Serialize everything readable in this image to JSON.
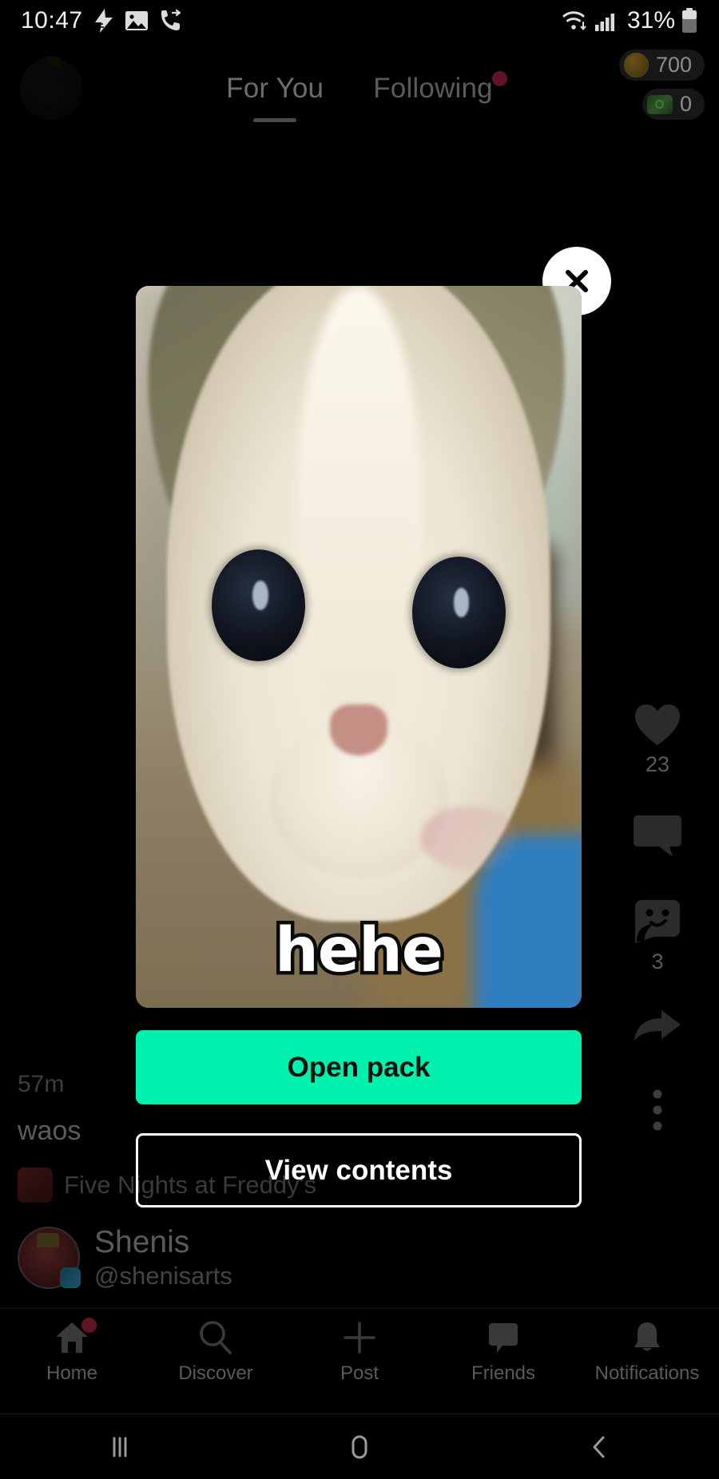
{
  "status_bar": {
    "time": "10:47",
    "battery_percent": "31%",
    "left_icons": [
      "flash-icon",
      "photo-icon",
      "call-forward-icon"
    ],
    "right_icons": [
      "wifi-icon",
      "cellular-signal-icon",
      "battery-icon"
    ]
  },
  "top_bar": {
    "avatar_name": "profile-avatar",
    "tabs": [
      {
        "label": "For You",
        "active": true,
        "has_dot": false
      },
      {
        "label": "Following",
        "active": false,
        "has_dot": true
      }
    ]
  },
  "currency": {
    "coins": {
      "icon": "coin-icon",
      "value": "700"
    },
    "cash": {
      "icon": "money-bill-icon",
      "value": "0"
    }
  },
  "action_rail": {
    "like": {
      "icon": "heart-icon",
      "count": "23"
    },
    "comment": {
      "icon": "comment-bubble-icon",
      "count": ""
    },
    "sticker": {
      "icon": "sticker-face-icon",
      "count": "3"
    },
    "share": {
      "icon": "share-arrow-icon",
      "count": ""
    },
    "more": {
      "icon": "more-vertical-icon",
      "count": ""
    }
  },
  "post_meta": {
    "timestamp": "57m",
    "caption": "waos",
    "game_tag": "Five Nights at Freddy's",
    "game_thumb": "game-thumbnail",
    "display_name": "Shenis",
    "handle": "@shenisarts"
  },
  "modal": {
    "close_label": "✕",
    "card_image_text": "hehe",
    "card_image_alt": "kitten-meme-image",
    "primary_button": "Open pack",
    "secondary_button": "View contents"
  },
  "bottom_nav": [
    {
      "label": "Home",
      "icon": "home-icon",
      "badge": true
    },
    {
      "label": "Discover",
      "icon": "search-icon",
      "badge": false
    },
    {
      "label": "Post",
      "icon": "plus-icon",
      "badge": false
    },
    {
      "label": "Friends",
      "icon": "friends-bubble-icon",
      "badge": false
    },
    {
      "label": "Notifications",
      "icon": "bell-icon",
      "badge": false
    }
  ],
  "android_nav": {
    "recents": "recents-icon",
    "home": "home-circle-icon",
    "back": "back-chevron-icon"
  },
  "colors": {
    "accent_green": "#00f0ad",
    "background": "#000000",
    "badge_red": "#5e1626",
    "text_muted": "#5a5a5a"
  }
}
